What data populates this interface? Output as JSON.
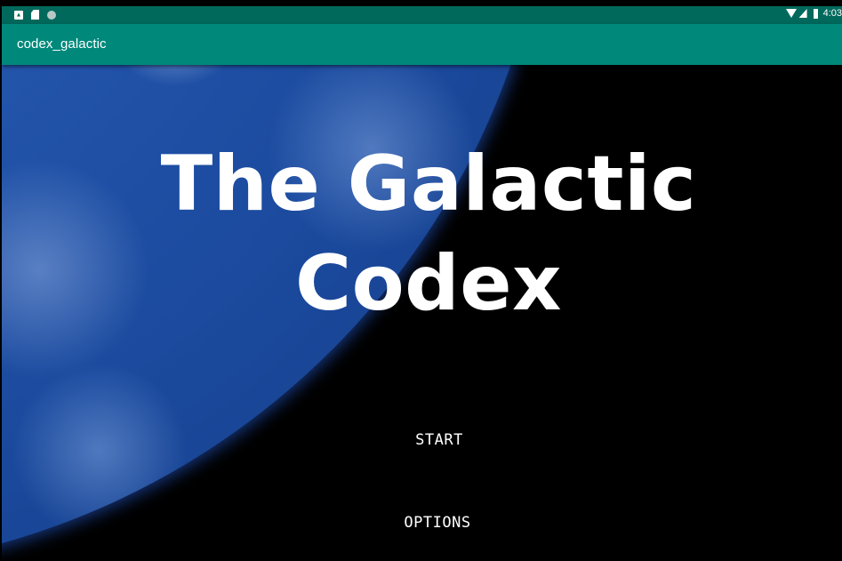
{
  "status_bar": {
    "time": "4:03",
    "icons": [
      "notification-a-icon",
      "sd-card-icon",
      "circle-icon",
      "wifi-icon",
      "signal-icon",
      "battery-icon"
    ]
  },
  "app_bar": {
    "title": "codex_galactic",
    "color": "#00897b"
  },
  "main": {
    "title_line1": "The Galactic",
    "title_line2": "Codex",
    "background": "earth-from-space-image"
  },
  "menu": {
    "start_label": "START",
    "options_label": "OPTIONS"
  },
  "colors": {
    "status_bar": "#00695c",
    "app_bar": "#00897b",
    "background": "#000000",
    "text": "#ffffff"
  }
}
